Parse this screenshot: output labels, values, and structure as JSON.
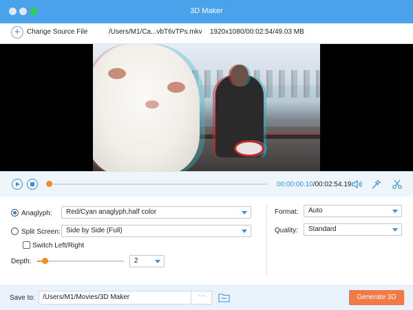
{
  "window": {
    "title": "3D Maker"
  },
  "source": {
    "change_label": "Change Source File",
    "file_path": "/Users/M1/Ca...vbT6vTPs.mkv",
    "file_meta": "1920x1080/00:02:54/49.03 MB"
  },
  "player": {
    "current_time": "00:00:00.10",
    "separator": "/",
    "total_time": "00:02:54.19",
    "progress": 0.0
  },
  "settings": {
    "anaglyph": {
      "label": "Anaglyph:",
      "selected": true,
      "value": "Red/Cyan anaglyph,half color"
    },
    "split_screen": {
      "label": "Split Screen:",
      "selected": false,
      "value": "Side by Side (Full)"
    },
    "switch_lr": {
      "label": "Switch Left/Right",
      "checked": false
    },
    "depth": {
      "label": "Depth:",
      "value": "2"
    },
    "format": {
      "label": "Format:",
      "value": "Auto"
    },
    "quality": {
      "label": "Quality:",
      "value": "Standard"
    }
  },
  "footer": {
    "save_label": "Save to:",
    "save_path": "/Users/M1/Movies/3D Maker",
    "browse_label": "···",
    "generate_label": "Generate 3D"
  },
  "colors": {
    "titlebar": "#4aa3ea",
    "accent": "#3d8fd8",
    "slider": "#f28a2c",
    "generate": "#f37a47"
  }
}
